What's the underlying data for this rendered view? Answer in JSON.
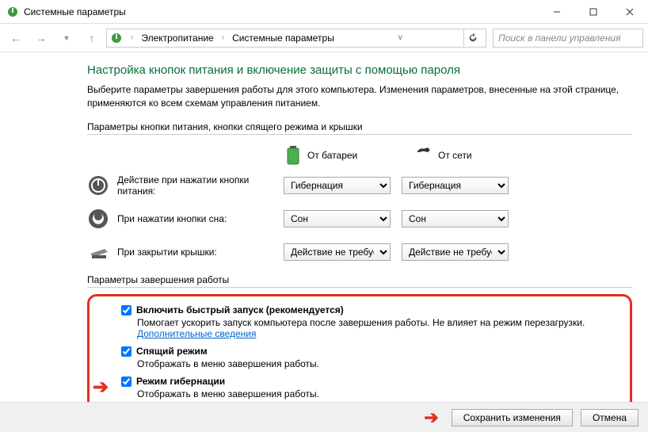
{
  "window": {
    "title": "Системные параметры"
  },
  "breadcrumb": {
    "items": [
      "Электропитание",
      "Системные параметры"
    ]
  },
  "search": {
    "placeholder": "Поиск в панели управления"
  },
  "page": {
    "title": "Настройка кнопок питания и включение защиты с помощью пароля",
    "description": "Выберите параметры завершения работы для этого компьютера. Изменения параметров, внесенные на этой странице, применяются ко всем схемам управления питанием."
  },
  "buttons_section": {
    "label": "Параметры кнопки питания, кнопки спящего режима и крышки",
    "col_battery": "От батареи",
    "col_ac": "От сети",
    "rows": [
      {
        "label": "Действие при нажатии кнопки питания:",
        "battery": "Гибернация",
        "ac": "Гибернация"
      },
      {
        "label": "При нажатии кнопки сна:",
        "battery": "Сон",
        "ac": "Сон"
      },
      {
        "label": "При закрытии крышки:",
        "battery": "Действие не требуется",
        "ac": "Действие не требуется"
      }
    ]
  },
  "shutdown_section": {
    "label": "Параметры завершения работы",
    "items": [
      {
        "title": "Включить быстрый запуск (рекомендуется)",
        "desc_prefix": "Помогает ускорить запуск компьютера после завершения работы. Не влияет на режим перезагрузки. ",
        "link": "Дополнительные сведения",
        "checked": true
      },
      {
        "title": "Спящий режим",
        "desc": "Отображать в меню завершения работы.",
        "checked": true
      },
      {
        "title": "Режим гибернации",
        "desc": "Отображать в меню завершения работы.",
        "checked": true
      }
    ]
  },
  "footer": {
    "save": "Сохранить изменения",
    "cancel": "Отмена"
  }
}
